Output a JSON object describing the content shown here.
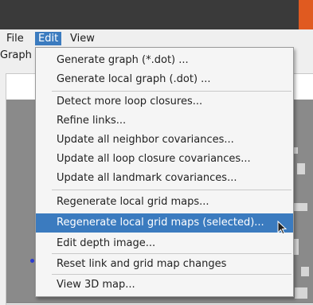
{
  "menubar": {
    "file": "File",
    "edit": "Edit",
    "view": "View"
  },
  "panel": {
    "graph_label": "Graph"
  },
  "edit_menu": {
    "items": [
      "Generate graph (*.dot) ...",
      "Generate local graph (.dot) ...",
      "Detect more loop closures...",
      "Refine links...",
      "Update all neighbor covariances...",
      "Update all loop closure covariances...",
      "Update all landmark covariances...",
      "Regenerate local grid maps...",
      "Regenerate local grid maps (selected)...",
      "Edit depth image...",
      "Reset link and grid map changes",
      "View 3D map..."
    ],
    "selected_index": 8
  },
  "colors": {
    "title_bar": "#3a3a3a",
    "accent": "#3b7bbf",
    "menu_bg": "#f5f5f5",
    "map_gray": "#8a8a8a",
    "node_blue": "#2b3bd1"
  },
  "icons": {
    "cursor": "arrow-cursor-icon"
  }
}
